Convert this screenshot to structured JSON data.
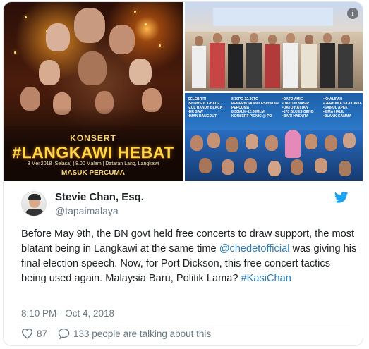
{
  "media": {
    "poster": {
      "title_small": "KONSERT",
      "title_big": "#LANGKAWI HEBAT",
      "details": "8 Mei 2018 (Selasa)  |  8.00 Malam  |  Dataran Lang, Langkawi",
      "free_entry": "MASUK PERCUMA"
    },
    "lineup": {
      "col1": [
        "SELEBRITI",
        "•SHAMSUL GHAU2",
        "•ZUL HANDY BLACK",
        "•DR SAW",
        "•IMAN DANGDUT"
      ],
      "col2": [
        "8.30PG-12.30TG",
        "PEMERIKSAAN KESIHATAN",
        "PERCUMA",
        "8.30MLM-12.00MLM",
        "KONSERT  PICNIC @ PD"
      ],
      "col3": [
        "•DATO AMIE",
        "•DATO M.NASIR",
        "•DATO HATTAN",
        "•170 BLUES GENG",
        "•BARI HASNITA"
      ],
      "col4": [
        "•KHALIFAH",
        "•GERHANA SKA CINTA",
        "•SAIFUL APEK",
        "•EIMA HALIL",
        "•BLANK GAMMA"
      ]
    },
    "info_icon": "info-icon"
  },
  "author": {
    "name": "Stevie Chan, Esq.",
    "handle": "@tapaimalaya",
    "avatar_icon": "avatar"
  },
  "tweet": {
    "text_part1": "Before May 9th, the BN govt held free concerts to draw support, the most blatant being in Langkawi at the same time ",
    "mention": "@chedetofficial",
    "text_part2": " was giving his final election speech. Now, for Port Dickson, this free concert tactics being used again. Malaysia Baru, Politik Lama? ",
    "hashtag": "#KasiChan"
  },
  "timestamp": "8:10 PM - Oct 4, 2018",
  "actions": {
    "likes": "87",
    "talking": "133 people are talking about this"
  },
  "colors": {
    "link": "#2b7bb9",
    "twitter_blue": "#1da1f2",
    "muted": "#697882"
  }
}
